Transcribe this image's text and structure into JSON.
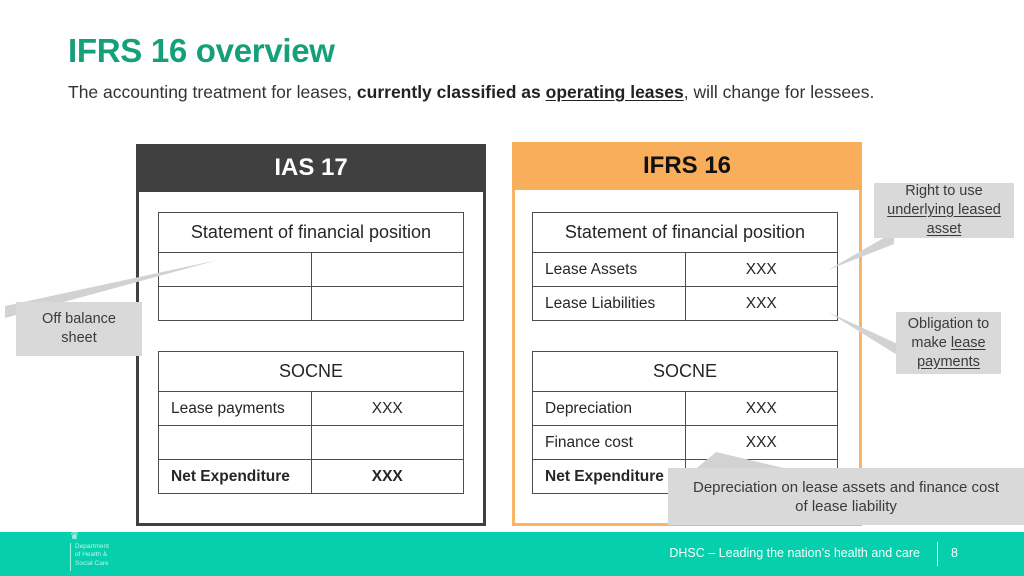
{
  "title": "IFRS 16 overview",
  "subtitle": {
    "part1": "The accounting treatment for leases, ",
    "bold1": "currently classified as ",
    "boldunderline": "operating leases",
    "part2": ", will change for lessees."
  },
  "colors": {
    "title_green": "#14a078",
    "footer_teal": "#05cfac",
    "ias_header": "#404040",
    "ifrs_header": "#f9ae5c",
    "ifrs_border": "#f7b567",
    "callout_gray": "#d9d9d9"
  },
  "panels": [
    {
      "id": "ias17",
      "heading": "IAS 17",
      "tables": [
        {
          "id": "sofp",
          "title": "Statement of financial position",
          "rows": [
            {
              "label": "",
              "value": ""
            },
            {
              "label": "",
              "value": ""
            }
          ]
        },
        {
          "id": "socne",
          "title": "SOCNE",
          "rows": [
            {
              "label": "Lease payments",
              "value": "XXX",
              "bold": false
            },
            {
              "label": "",
              "value": "",
              "bold": false
            },
            {
              "label": "Net Expenditure",
              "value": "XXX",
              "bold": true
            }
          ]
        }
      ]
    },
    {
      "id": "ifrs16",
      "heading": "IFRS 16",
      "tables": [
        {
          "id": "sofp",
          "title": "Statement of financial position",
          "rows": [
            {
              "label": "Lease Assets",
              "value": "XXX",
              "bold": false
            },
            {
              "label": "Lease Liabilities",
              "value": "XXX",
              "bold": false
            }
          ]
        },
        {
          "id": "socne",
          "title": "SOCNE",
          "rows": [
            {
              "label": "Depreciation",
              "value": "XXX",
              "bold": false
            },
            {
              "label": "Finance cost",
              "value": "XXX",
              "bold": false
            },
            {
              "label": "Net Expenditure",
              "value": "",
              "bold": true
            }
          ]
        }
      ]
    }
  ],
  "callouts": {
    "off_balance": {
      "line1": "Off balance",
      "line2": "sheet"
    },
    "right_to_use": {
      "plain": "Right to use",
      "underlined": "underlying leased asset"
    },
    "obligation": {
      "plain": "Obligation to make ",
      "underlined": "lease payments"
    },
    "depreciation": {
      "line1": "Depreciation on lease assets and finance cost",
      "line2": "of lease liability"
    }
  },
  "footer": {
    "text": "DHSC – Leading the nation’s health and care",
    "page": "8",
    "logo_line1": "Department",
    "logo_line2": "of Health &",
    "logo_line3": "Social Care"
  }
}
